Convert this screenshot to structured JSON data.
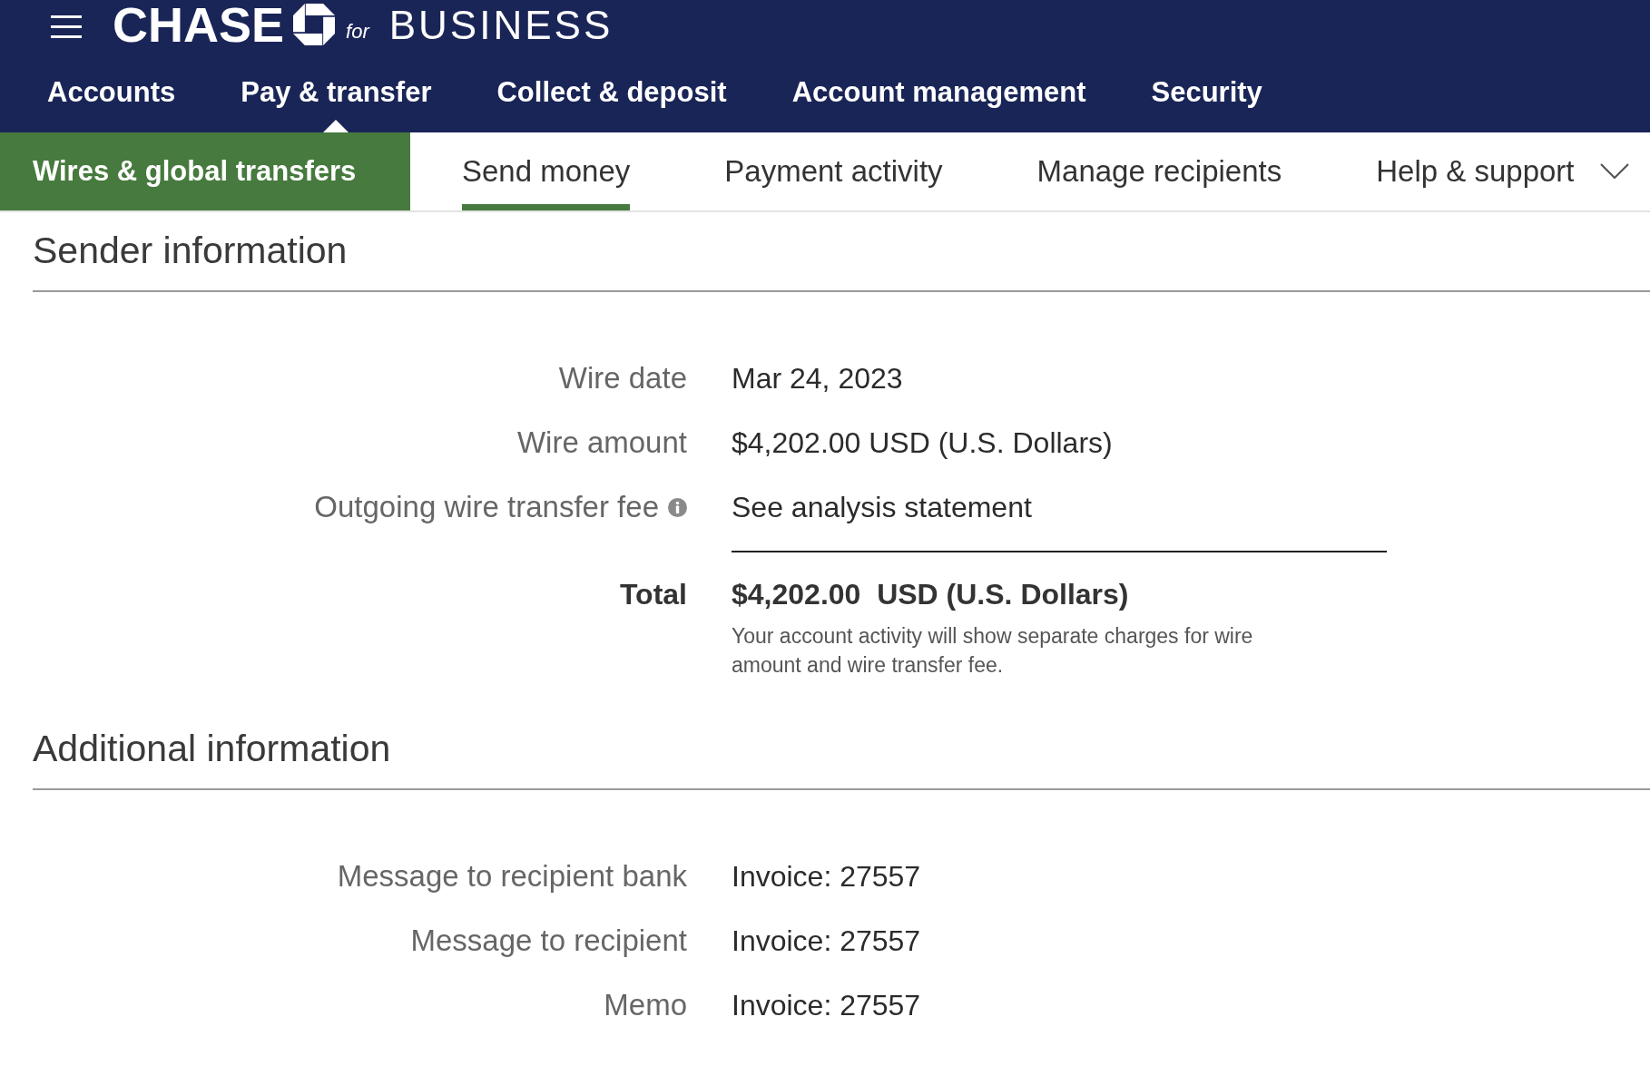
{
  "header": {
    "logo": {
      "brand": "CHASE",
      "tagline_prefix": "for",
      "tagline": "BUSINESS"
    },
    "nav": [
      {
        "label": "Accounts",
        "selected": false
      },
      {
        "label": "Pay & transfer",
        "selected": true
      },
      {
        "label": "Collect & deposit",
        "selected": false
      },
      {
        "label": "Account management",
        "selected": false
      },
      {
        "label": "Security",
        "selected": false
      }
    ]
  },
  "subnav": {
    "section": "Wires & global transfers",
    "tabs": [
      {
        "label": "Send money",
        "selected": true,
        "kind": "link"
      },
      {
        "label": "Payment activity",
        "selected": false,
        "kind": "link"
      },
      {
        "label": "Manage recipients",
        "selected": false,
        "kind": "link"
      },
      {
        "label": "Help & support",
        "selected": false,
        "kind": "dropdown"
      }
    ]
  },
  "sections": [
    {
      "title": "Sender information",
      "rows": [
        {
          "label": "Wire date",
          "value": "Mar 24, 2023",
          "kind": "plain"
        },
        {
          "label": "Wire amount",
          "value": "$4,202.00 USD (U.S. Dollars)",
          "kind": "plain"
        },
        {
          "label": "Outgoing wire transfer fee",
          "value": "See analysis statement",
          "kind": "info"
        },
        {
          "label": "Total",
          "value": "$4,202.00  USD (U.S. Dollars)",
          "note": "Your account activity will show separate charges for wire amount and wire transfer fee.",
          "kind": "total"
        }
      ]
    },
    {
      "title": "Additional information",
      "rows": [
        {
          "label": "Message to recipient bank",
          "value": "Invoice: 27557",
          "kind": "plain"
        },
        {
          "label": "Message to recipient",
          "value": "Invoice: 27557",
          "kind": "plain"
        },
        {
          "label": "Memo",
          "value": "Invoice: 27557",
          "kind": "plain"
        }
      ]
    }
  ]
}
